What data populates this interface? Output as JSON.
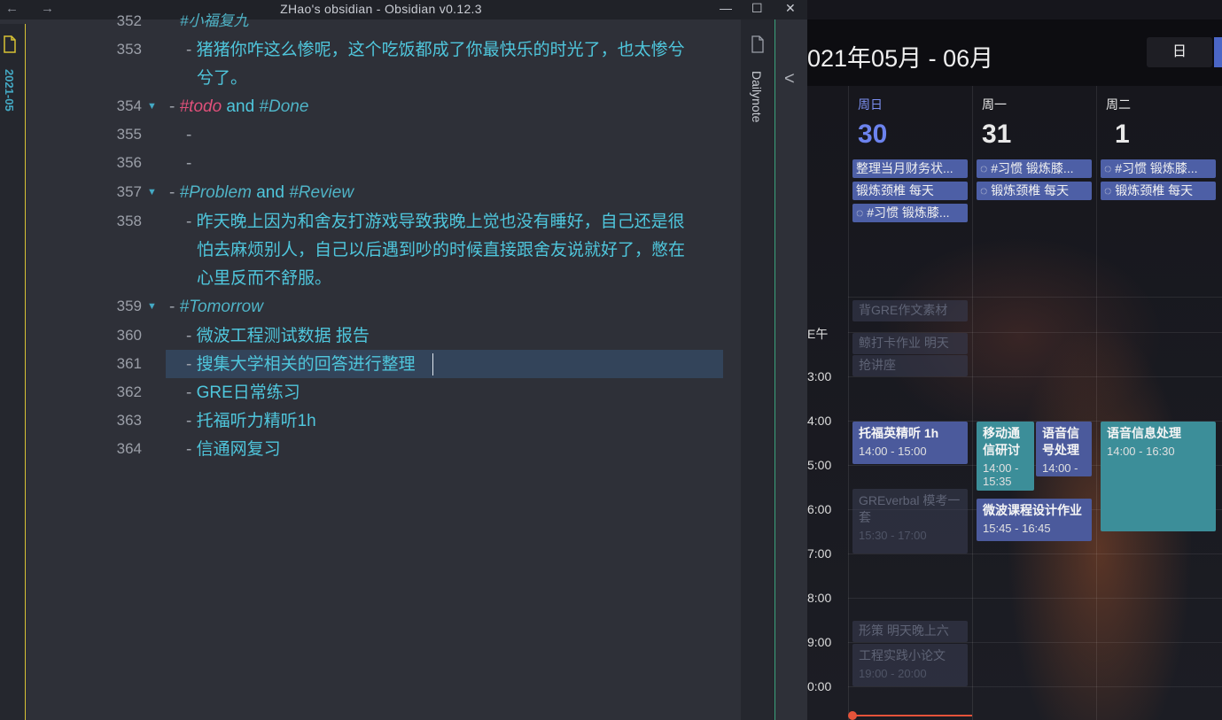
{
  "titlebar": {
    "title": "ZHao's obsidian - Obsidian v0.12.3",
    "back": "←",
    "forward": "→",
    "minimize": "—",
    "maximize": "☐",
    "close": "✕"
  },
  "left_panel": {
    "vertical_tab": "2021-05"
  },
  "right_panel": {
    "vertical_tab": "Dailynote"
  },
  "editor": {
    "partial_top": "#小福复九",
    "lines": [
      {
        "num": "353",
        "dash": "- ",
        "text": "猪猪你咋这么惨呢，这个吃饭都成了你最快乐的时光了，也太惨兮",
        "cont": "兮了。"
      },
      {
        "num": "354",
        "dash": "- ",
        "tag1": "#todo",
        "mid": " and ",
        "tag2": "#Done"
      },
      {
        "num": "355",
        "dash": "-"
      },
      {
        "num": "356",
        "dash": "-"
      },
      {
        "num": "357",
        "dash": "- ",
        "tag1": "#Problem",
        "mid": " and ",
        "tag2": "#Review"
      },
      {
        "num": "358",
        "dash": "- ",
        "text": "昨天晚上因为和舍友打游戏导致我晚上觉也没有睡好，自己还是很",
        "cont": "怕去麻烦别人，自己以后遇到吵的时候直接跟舍友说就好了，憋在",
        "cont2": "心里反而不舒服。"
      },
      {
        "num": "359",
        "dash": "- ",
        "tag1": "#Tomorrow"
      },
      {
        "num": "360",
        "dash": "- ",
        "text": "微波工程测试数据 报告"
      },
      {
        "num": "361",
        "dash": "- ",
        "text": "搜集大学相关的回答进行整理"
      },
      {
        "num": "362",
        "dash": "- ",
        "text": "GRE日常练习"
      },
      {
        "num": "363",
        "dash": "- ",
        "text": "托福听力精听1h"
      },
      {
        "num": "364",
        "dash": "- ",
        "text": "信通网复习"
      }
    ],
    "fold_icon": "▼"
  },
  "calendar": {
    "back": "<",
    "month_title": "021年05月 - 06月",
    "view_day": "日",
    "days": [
      {
        "name": "周日",
        "num": "30"
      },
      {
        "name": "周一",
        "num": "31"
      },
      {
        "name": "周二",
        "num": "1"
      }
    ],
    "allday": [
      [
        "整理当月财务状...",
        "锻炼颈椎 每天",
        "◌ #习惯 锻炼膝..."
      ],
      [
        "◌ #习惯 锻炼膝...",
        "◌ 锻炼颈椎 每天"
      ],
      [
        "◌ #习惯 锻炼膝...",
        "◌ 锻炼颈椎 每天"
      ]
    ],
    "time_labels": [
      "E午",
      "3:00",
      "4:00",
      "5:00",
      "6:00",
      "7:00",
      "8:00",
      "9:00",
      "0:00"
    ],
    "events": {
      "gre_writing": "背GRE作文素材",
      "clock_hw": "鲸打卡作业 明天",
      "lecture": "抢讲座",
      "toefl": {
        "title": "托福英精听 1h",
        "time": "14:00 - 15:00"
      },
      "gre_verbal": {
        "title": "GREverbal 模考一套",
        "time": "15:30 - 17:00"
      },
      "policy": "形策 明天晚上六",
      "eng_paper": {
        "title": "工程实践小论文",
        "time": "19:00 - 20:00"
      },
      "mobile_comm": {
        "title": "移动通信研讨",
        "time": "14:00 - 15:35"
      },
      "speech_sig": {
        "title": "语音信号处理",
        "time": "14:00 -"
      },
      "microwave": {
        "title": "微波课程设计作业",
        "time": "15:45 - 16:45"
      },
      "speech_info": {
        "title": "语音信息处理",
        "time": "14:00 - 16:30"
      }
    }
  },
  "colors": {
    "accent_blue": "#4b66c6",
    "tag_pink": "#e0507a",
    "text_teal": "#4fc6dc",
    "now_line": "#e5533a"
  }
}
